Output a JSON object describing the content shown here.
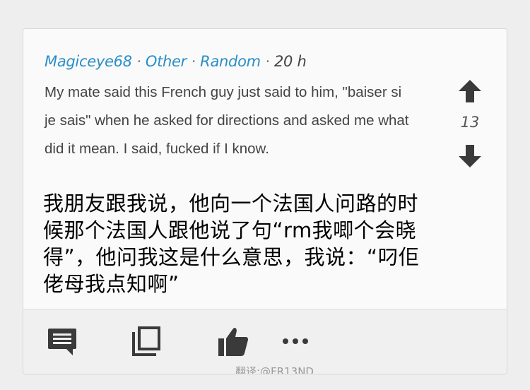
{
  "post": {
    "author": "Magiceye68",
    "separator": "·",
    "category": "Other",
    "subcategory": "Random",
    "time": "20 h",
    "comment": "My mate said this French guy just said to him, \"baiser si je sais\" when he asked for directions and asked me what did it mean. I said, fucked if I know.",
    "translation": "我朋友跟我说，他向一个法国人问路的时候那个法国人跟他说了句“rm我唧个会晓得”，他问我这是什么意思，我说：“叼佢佬母我点知啊”"
  },
  "votes": {
    "score": "13",
    "up_icon": "arrow-up-icon",
    "down_icon": "arrow-down-icon"
  },
  "actions": [
    {
      "icon": "comment-icon"
    },
    {
      "icon": "copy-icon"
    },
    {
      "icon": "thumbs-up-icon"
    },
    {
      "icon": "more-icon"
    }
  ],
  "watermark": "翻译:@FR13ND",
  "colors": {
    "link": "#2a8fc7",
    "icon": "#3a3a3a",
    "body_text": "#444444"
  }
}
